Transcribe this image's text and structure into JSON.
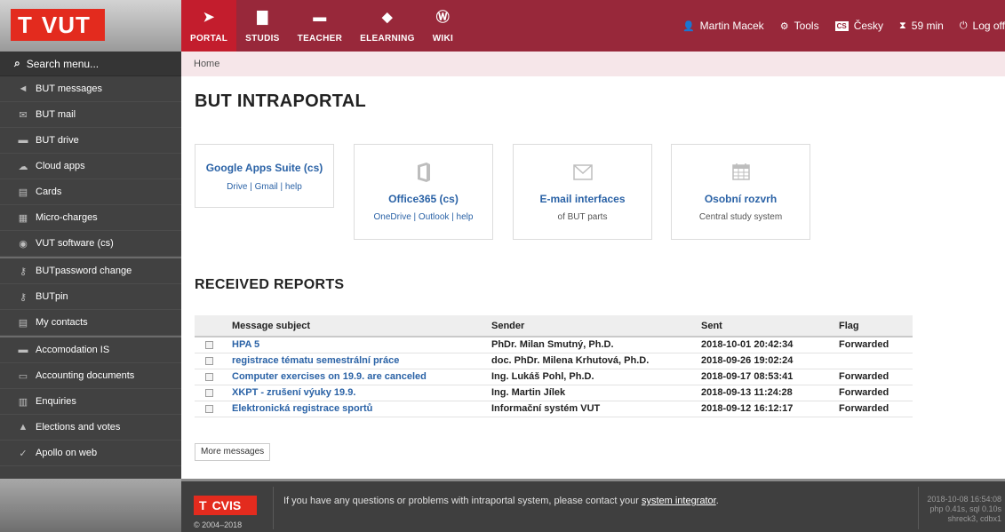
{
  "brand": {
    "logo_letter": "T",
    "logo_text": "VUT"
  },
  "topnav": [
    {
      "label": "PORTAL",
      "icon": "paper-plane-icon",
      "glyph": "➤",
      "active": true
    },
    {
      "label": "STUDIS",
      "icon": "book-icon",
      "glyph": "▇",
      "active": false
    },
    {
      "label": "TEACHER",
      "icon": "briefcase-icon",
      "glyph": "▬",
      "active": false
    },
    {
      "label": "ELEARNING",
      "icon": "graduation-cap-icon",
      "glyph": "◆",
      "active": false
    },
    {
      "label": "WIKI",
      "icon": "wordpress-icon",
      "glyph": "Ⓦ",
      "active": false
    }
  ],
  "topright": {
    "user": "Martin Macek",
    "tools": "Tools",
    "lang_badge": "CS",
    "language": "Česky",
    "timer": "59 min",
    "logoff": "Log off"
  },
  "sidebar": {
    "search_placeholder": "Search menu...",
    "items": [
      {
        "label": "BUT messages",
        "icon": "megaphone-icon",
        "glyph": "📢"
      },
      {
        "label": "BUT mail",
        "icon": "mail-icon",
        "glyph": "✉"
      },
      {
        "label": "BUT drive",
        "icon": "drive-icon",
        "glyph": "▬"
      },
      {
        "label": "Cloud apps",
        "icon": "cloud-icon",
        "glyph": "☁"
      },
      {
        "label": "Cards",
        "icon": "id-card-icon",
        "glyph": "▤"
      },
      {
        "label": "Micro-charges",
        "icon": "money-icon",
        "glyph": "▦"
      },
      {
        "label": "VUT software (cs)",
        "icon": "disc-icon",
        "glyph": "◉"
      },
      {
        "label": "BUTpassword change",
        "icon": "key-icon",
        "glyph": "⚷"
      },
      {
        "label": "BUTpin",
        "icon": "key-icon",
        "glyph": "⚷"
      },
      {
        "label": "My contacts",
        "icon": "contacts-icon",
        "glyph": "▤"
      },
      {
        "label": "Accomodation IS",
        "icon": "bed-icon",
        "glyph": "▬"
      },
      {
        "label": "Accounting documents",
        "icon": "document-icon",
        "glyph": "▭"
      },
      {
        "label": "Enquiries",
        "icon": "clipboard-icon",
        "glyph": "▥"
      },
      {
        "label": "Elections and votes",
        "icon": "thumbs-up-icon",
        "glyph": "👍"
      },
      {
        "label": "Apollo on web",
        "icon": "apollo-icon",
        "glyph": "✓"
      }
    ]
  },
  "breadcrumb": "Home",
  "page_title": "BUT INTRAPORTAL",
  "tiles": [
    {
      "title": "Google Apps Suite (cs)",
      "sub": "Drive | Gmail | help",
      "icon": "",
      "glyph": ""
    },
    {
      "title": "Office365 (cs)",
      "sub": "OneDrive | Outlook | help",
      "icon": "office-icon",
      "glyph": "▯"
    },
    {
      "title": "E-mail interfaces",
      "sub": "of BUT parts",
      "icon": "envelope-icon",
      "glyph": "✉"
    },
    {
      "title": "Osobní rozvrh",
      "sub": "Central study system",
      "icon": "calendar-icon",
      "glyph": "▦"
    }
  ],
  "reports": {
    "title": "RECEIVED REPORTS",
    "columns": [
      "Message subject",
      "Sender",
      "Sent",
      "Flag"
    ],
    "rows": [
      {
        "subject": "HPA 5",
        "sender": "PhDr. Milan Smutný, Ph.D.",
        "sent": "2018-10-01 20:42:34",
        "flag": "Forwarded"
      },
      {
        "subject": "registrace tématu semestrální práce",
        "sender": "doc. PhDr. Milena Krhutová, Ph.D.",
        "sent": "2018-09-26 19:02:24",
        "flag": ""
      },
      {
        "subject": "Computer exercises on 19.9. are canceled",
        "sender": "Ing. Lukáš Pohl, Ph.D.",
        "sent": "2018-09-17 08:53:41",
        "flag": "Forwarded"
      },
      {
        "subject": "XKPT - zrušení výuky 19.9.",
        "sender": "Ing. Martin Jílek",
        "sent": "2018-09-13 11:24:28",
        "flag": "Forwarded"
      },
      {
        "subject": "Elektronická registrace sportů",
        "sender": "Informační systém VUT",
        "sent": "2018-09-12 16:12:17",
        "flag": "Forwarded"
      }
    ],
    "more_label": "More messages"
  },
  "footer": {
    "logo_letter": "T",
    "logo_text": "CVIS",
    "copyright": "© 2004–2018",
    "message": "If you have any questions or problems with intraportal system, please contact your ",
    "link": "system integrator",
    "message_end": ".",
    "stats": [
      "2018-10-08 16:54:08",
      "php 0.41s, sql 0.10s",
      "shreck3, cdbx1"
    ]
  },
  "colors": {
    "brand_red": "#e32b1e",
    "topbar": "#98283a",
    "active_tab": "#c31d2d",
    "sidebar": "#414141",
    "link": "#2a62a6"
  }
}
